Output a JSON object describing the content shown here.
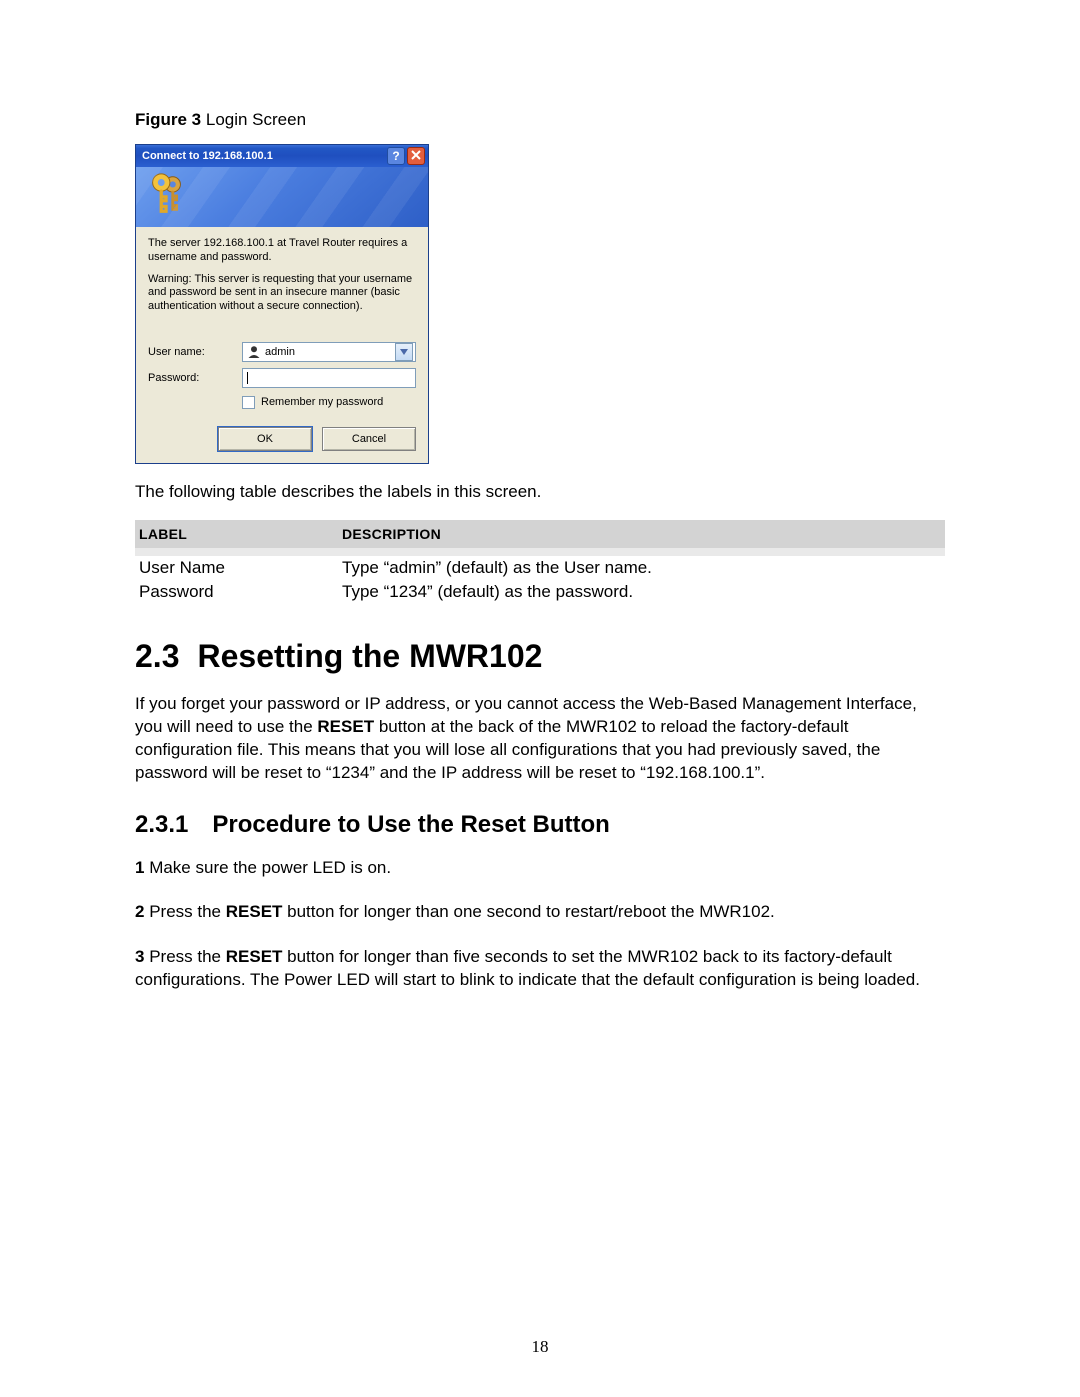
{
  "figure": {
    "label": "Figure 3",
    "title": "Login Screen"
  },
  "dialog": {
    "title": "Connect to 192.168.100.1",
    "server_msg": "The server 192.168.100.1 at Travel Router requires a username and password.",
    "warning_msg": "Warning: This server is requesting that your username and password be sent in an insecure manner (basic authentication without a secure connection).",
    "user_label": "User name:",
    "user_value": "admin",
    "password_label": "Password:",
    "remember_label": "Remember my password",
    "ok": "OK",
    "cancel": "Cancel"
  },
  "table_intro": "The following table describes the labels in this screen.",
  "table": {
    "headers": {
      "label": "Label",
      "description": "Description"
    },
    "rows": [
      {
        "label": "User Name",
        "description": "Type “admin” (default) as the User name."
      },
      {
        "label": "Password",
        "description": "Type “1234” (default) as the password."
      }
    ]
  },
  "section": {
    "number": "2.3",
    "title": "Resetting the MWR102",
    "para_parts": [
      "If you forget your password or IP address, or you cannot access the Web-Based Management Interface, you will need to use the ",
      "RESET",
      " button at the back of the MWR102 to reload the factory-default configuration file. This means that you will lose all configurations that you had previously saved, the password will be reset to “1234” and the IP address will be reset to “192.168.100.1”."
    ]
  },
  "subsection": {
    "number": "2.3.1",
    "title": "Procedure to Use the Reset Button",
    "steps": [
      {
        "n": "1",
        "parts": [
          " Make sure the power LED is on."
        ]
      },
      {
        "n": "2",
        "parts": [
          " Press the ",
          "RESET",
          " button for longer than one second to restart/reboot the MWR102."
        ]
      },
      {
        "n": "3",
        "parts": [
          " Press the ",
          "RESET",
          " button for longer than five seconds to set the MWR102 back to its factory-default configurations. The Power LED will start to blink to indicate that the default configuration is being loaded."
        ]
      }
    ]
  },
  "page_number": "18"
}
